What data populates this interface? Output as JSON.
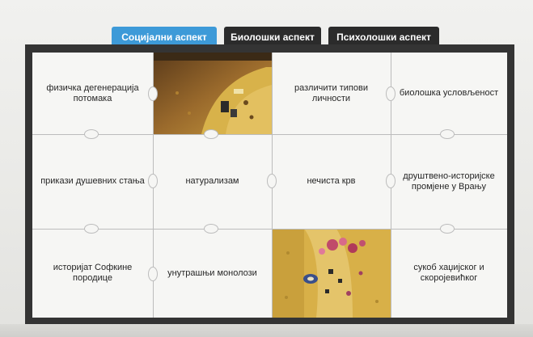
{
  "tabs": [
    {
      "label": "Социјални аспект",
      "active": true
    },
    {
      "label": "Биолошки аспект",
      "active": false
    },
    {
      "label": "Психолошки аспект",
      "active": false
    }
  ],
  "puzzle": {
    "rows": [
      [
        "физичка дегенерација потомака",
        "",
        "различити типови личности",
        "биолошка условљеност"
      ],
      [
        "прикази душевних стања",
        "натурализам",
        "нечиста крв",
        "друштвено-историјске промјене у Врању"
      ],
      [
        "историјат Софкине породице",
        "унутрашњи монолози",
        "",
        "сукоб хаџијског и скоројевићког"
      ]
    ],
    "image_pieces": [
      "klimt-painting-fragment-top",
      "klimt-painting-fragment-bottom"
    ]
  },
  "colors": {
    "tab_active": "#3d9ad8",
    "tab_inactive": "#2b2b2b",
    "board_frame": "#343434",
    "piece_bg": "#f6f6f4"
  }
}
